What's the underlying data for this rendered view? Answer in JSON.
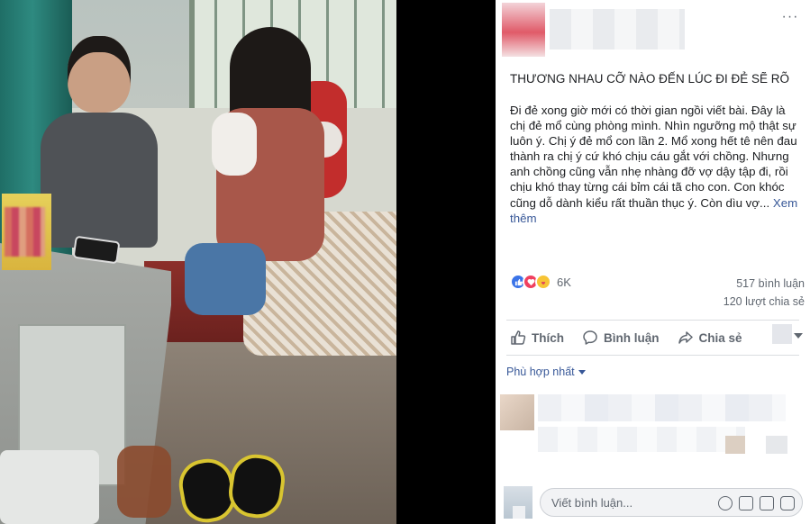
{
  "post": {
    "title": "THƯƠNG NHAU CỠ NÀO ĐẾN LÚC ĐI ĐẺ SẼ RÕ",
    "body": "Đi đẻ xong giờ mới có thời gian ngồi viết bài. Đây là chị đẻ mổ cùng phòng mình. Nhìn ngưỡng mộ thật sự luôn ý. Chị ý đẻ mổ con lần 2. Mổ xong hết tê nên đau thành ra chị ý cứ khó chịu cáu gắt với chồng. Nhưng anh chồng cũng vẫn nhẹ nhàng đỡ vợ dậy tập đi, rồi chịu khó thay từng cái bỉm cái tã cho con. Con khóc cũng dỗ dành kiểu rất thuần thục ý. Còn dìu vợ...",
    "see_more": "Xem thêm",
    "more_menu": "···"
  },
  "reactions": {
    "count": "6K",
    "icons": [
      "like-icon",
      "love-icon",
      "care-icon"
    ]
  },
  "stats": {
    "comments": "517 bình luận",
    "shares": "120 lượt chia sẻ"
  },
  "actions": {
    "like": "Thích",
    "comment": "Bình luận",
    "share": "Chia sẻ"
  },
  "filter": {
    "label": "Phù hợp nhất"
  },
  "comment_box": {
    "placeholder": "Viết bình luận..."
  },
  "colors": {
    "link": "#385898",
    "muted": "#606770",
    "like": "#3b74e8",
    "love": "#f0405f"
  }
}
